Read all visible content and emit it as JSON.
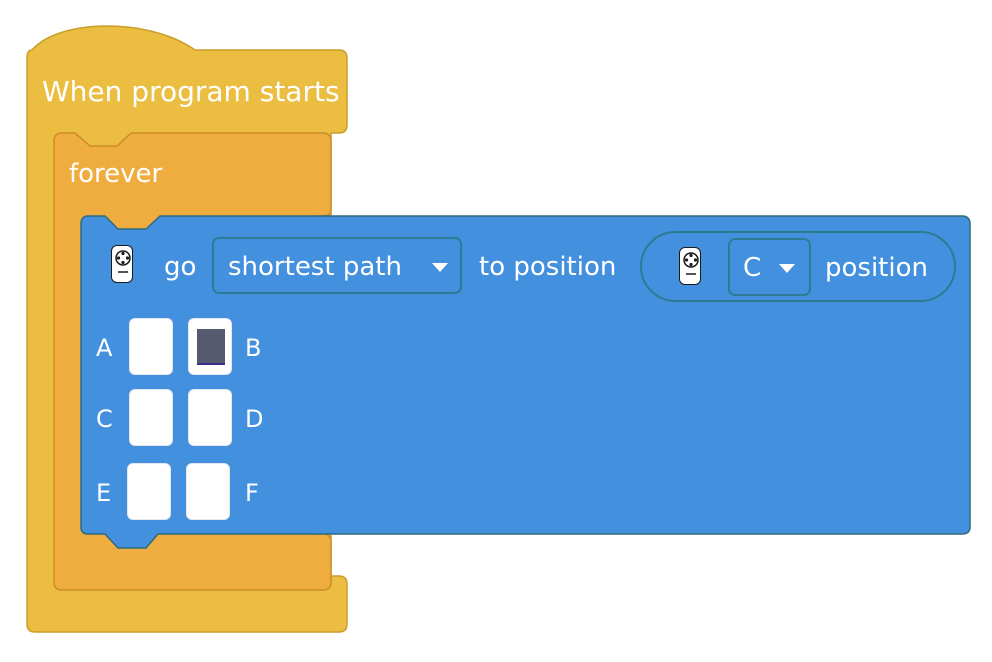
{
  "hat_block": {
    "label": "When program starts",
    "color": "#ebbe42"
  },
  "forever_block": {
    "label": "forever",
    "color": "#f0ad3f"
  },
  "go_block": {
    "color": "#4390df",
    "icon": "remote-controller-icon",
    "go_label": "go",
    "path_dropdown": {
      "selected": "shortest path"
    },
    "to_label": "to position",
    "position_reporter": {
      "icon": "remote-controller-icon",
      "selected": "C",
      "label": "position"
    },
    "grid": {
      "labels": [
        "A",
        "B",
        "C",
        "D",
        "E",
        "F"
      ],
      "selected": "B"
    }
  }
}
